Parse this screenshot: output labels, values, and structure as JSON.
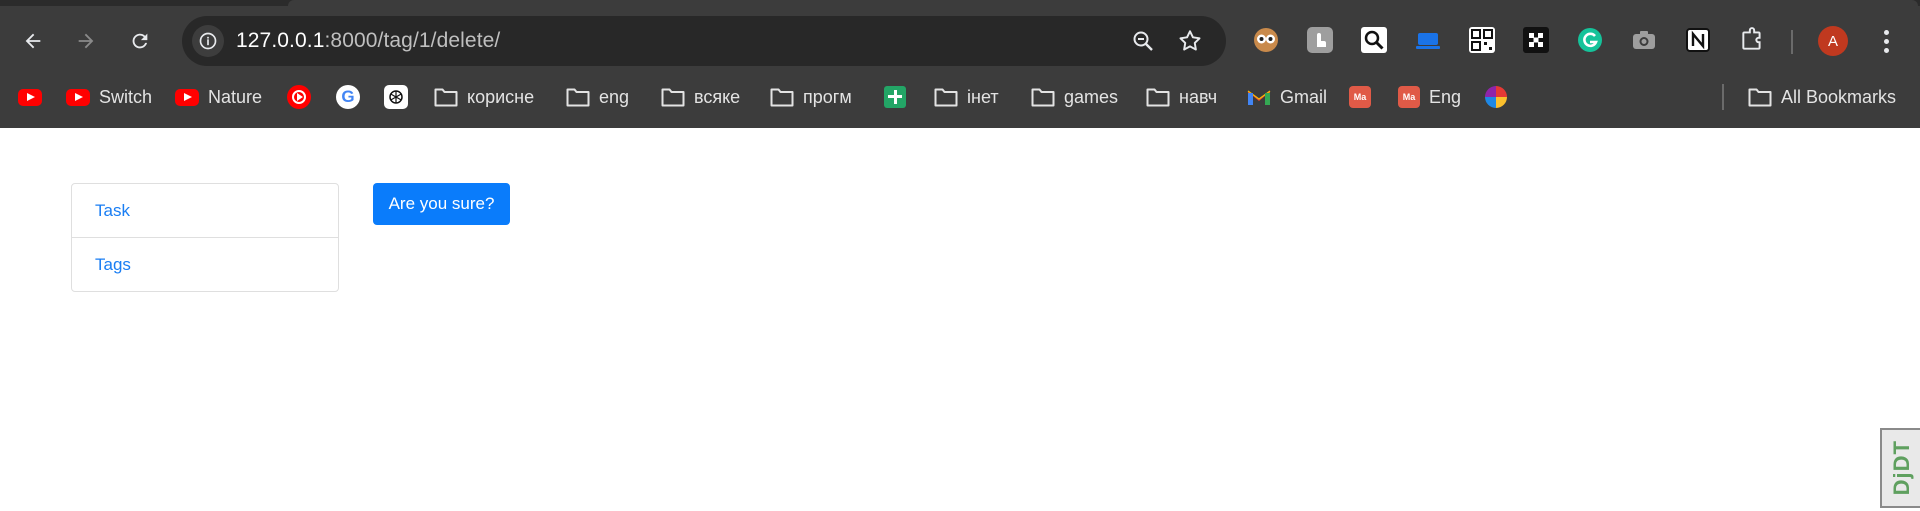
{
  "browser": {
    "address_bar": {
      "host": "127.0.0.1",
      "path": ":8000/tag/1/delete/"
    },
    "profile_initial": "A",
    "bookmarks": [
      {
        "icon": "youtube-icon",
        "label": ""
      },
      {
        "icon": "youtube-icon",
        "label": "Switch"
      },
      {
        "icon": "youtube-icon",
        "label": "Nature"
      },
      {
        "icon": "youtube-music-icon",
        "label": ""
      },
      {
        "icon": "google-icon",
        "label": ""
      },
      {
        "icon": "openai-icon",
        "label": ""
      },
      {
        "icon": "folder-icon",
        "label": "корисне"
      },
      {
        "icon": "folder-icon",
        "label": "eng"
      },
      {
        "icon": "folder-icon",
        "label": "всяке"
      },
      {
        "icon": "folder-icon",
        "label": "прогм"
      },
      {
        "icon": "sheets-icon",
        "label": ""
      },
      {
        "icon": "folder-icon",
        "label": "інет"
      },
      {
        "icon": "folder-icon",
        "label": "games"
      },
      {
        "icon": "folder-icon",
        "label": "навч"
      },
      {
        "icon": "gmail-icon",
        "label": "Gmail"
      },
      {
        "icon": "ma-icon",
        "label": ""
      },
      {
        "icon": "ma-icon",
        "label": "Eng"
      },
      {
        "icon": "multicolor-icon",
        "label": ""
      }
    ],
    "all_bookmarks_label": "All Bookmarks",
    "ma_icon_text": "Ma"
  },
  "page": {
    "sidebar": {
      "items": [
        {
          "label": "Task"
        },
        {
          "label": "Tags"
        }
      ]
    },
    "confirm_button_label": "Are you sure?",
    "debug_toolbar_label": "DjDT"
  },
  "colors": {
    "link": "#1a7ef3",
    "primary_button": "#0a7cfb",
    "chrome_bg": "#3c3c3c"
  }
}
